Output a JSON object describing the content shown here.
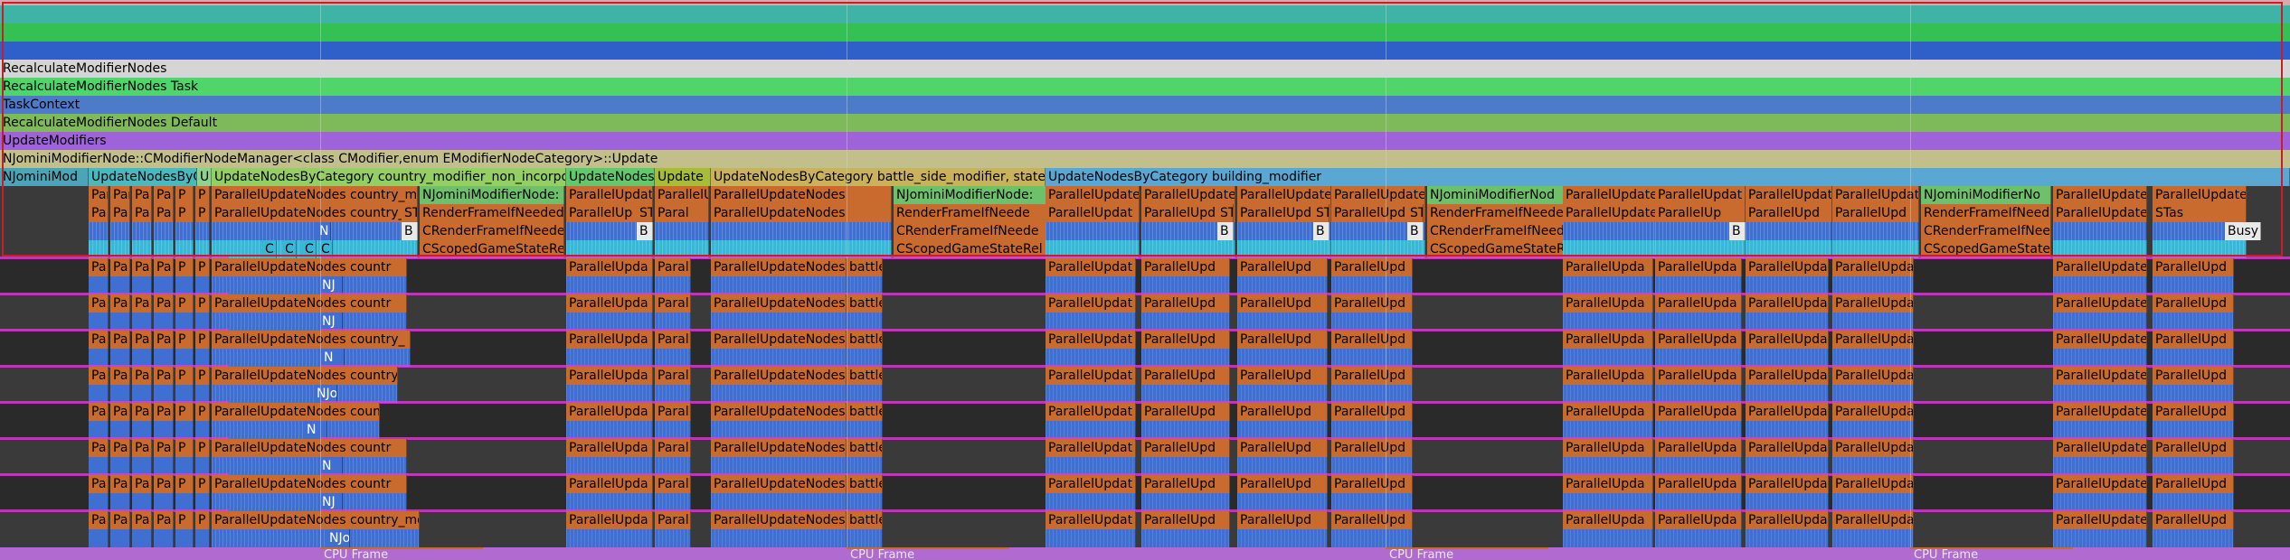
{
  "summary_rows": [
    {
      "label": "RecalculateModifierNodes",
      "color": "#d5d5d5"
    },
    {
      "label": "RecalculateModifierNodes Task",
      "color": "#4fd56a"
    },
    {
      "label": "TaskContext",
      "color": "#4d7ac9"
    },
    {
      "label": "RecalculateModifierNodes Default",
      "color": "#7fba5a"
    },
    {
      "label": "UpdateModifiers",
      "color": "#9e62d9"
    },
    {
      "label": "NJominiModifierNode::CModifierNodeManager<class CModifier,enum EModifierNodeCategory>::Update",
      "color": "#c2bf8a"
    }
  ],
  "category_row": [
    {
      "label": "NJominiMod",
      "color": "#4aa6b6"
    },
    {
      "label": "UpdateNodesByC",
      "color": "#49b9bf"
    },
    {
      "label": "U",
      "color": "#8fd18f"
    },
    {
      "label": "UpdateNodesByCategory country_modifier_non_incorpo",
      "color": "#93cf63"
    },
    {
      "label": "UpdateNodes",
      "color": "#61c86b"
    },
    {
      "label": "Update",
      "color": "#a6bd3c"
    },
    {
      "label": "UpdateNodesByCategory battle_side_modifier, state_",
      "color": "#c9b25b"
    },
    {
      "label": "UpdateNodesByCategory building_modifier",
      "color": "#5aa7d4"
    }
  ],
  "labels": {
    "pa": "Pa",
    "par": "Par",
    "p": "P",
    "u": "U",
    "puc": "ParallelUpdateNodes country_mo",
    "pucu": "ParallelUpdateNodes country_",
    "puc2": "ParallelUpdateNodes countr",
    "puc3": "ParallelUpdateNodes country",
    "puc4": "ParallelUpdateNodes count",
    "puc5": "ParallelUpdateNodes country_mo",
    "njmn": "NJominiModifierNode:",
    "njmn2": "NJominiModifierNode:",
    "njmn3": "NJominiModifierNod",
    "njmn4": "NJominiModifierNo",
    "pu": "ParallelUpdat",
    "pu2": "ParallelUpdate",
    "pu3": "ParallelUpda",
    "pu4": "ParallelUpd",
    "pu5": "ParallelUp",
    "pu6": "ParallelUpdateNo",
    "paral": "Paral",
    "parall": "Parall",
    "pun": "ParallelUpdateNodes",
    "battle_s": "battle_s",
    "battle": "battle",
    "battle_": "battle_",
    "st": "ST",
    "s": "S",
    "b": "B",
    "rfn": "RenderFrameIfNeeded",
    "rfn2": "RenderFrameIfNeede",
    "rfn3": "RenderFrameIfNeed",
    "crfn": "CRenderFrameIfNeede",
    "crfn2": "CRenderFrameIfNeede",
    "crfn3": "CRenderFrameIfNee",
    "csg": "CScopedGameStateRel",
    "csg2": "CScopedGameStateRel",
    "csg3": "CScopedGameStateR",
    "stas": "STas",
    "busy": "Busy",
    "n": "N",
    "nj": "NJ",
    "njo": "NJo",
    "c": "C"
  },
  "cpu_frame_label": "CPU Frame",
  "colors": {
    "orange": "#c96b2e",
    "blue": "#3e6fd1",
    "cyan": "#36b8d6",
    "teal": "#2a8fa6",
    "selection": "#c81e2b",
    "magenta": "#e23be2"
  }
}
